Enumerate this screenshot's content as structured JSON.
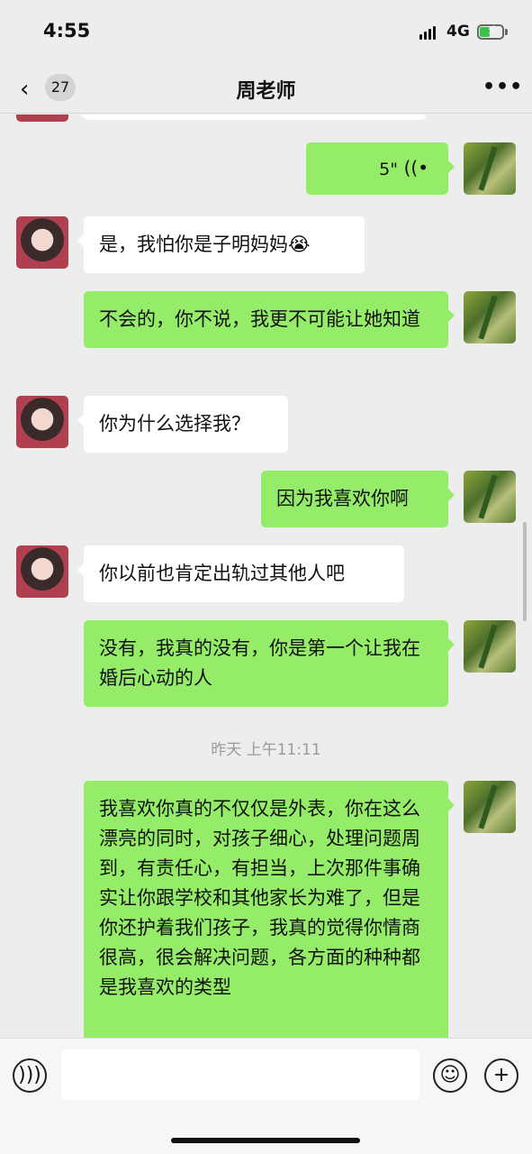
{
  "status": {
    "time": "4:55",
    "network": "4G"
  },
  "nav": {
    "back_icon": "‹",
    "unread_count": "27",
    "title": "周老师",
    "more_icon": "•••"
  },
  "messages": [
    {
      "side": "out",
      "type": "voice",
      "duration": "5\""
    },
    {
      "side": "in",
      "text": "是，我怕你是子明妈妈😭"
    },
    {
      "side": "out",
      "text": "不会的，你不说，我更不可能让她知道"
    },
    {
      "side": "in",
      "text": "你为什么选择我？"
    },
    {
      "side": "out",
      "text": "因为我喜欢你啊"
    },
    {
      "side": "in",
      "text": "你以前也肯定出轨过其他人吧"
    },
    {
      "side": "out",
      "text": "没有，我真的没有，你是第一个让我在婚后心动的人"
    },
    {
      "side": "out",
      "text": "我喜欢你真的不仅仅是外表，你在这么漂亮的同时，对孩子细心，处理问题周到，有责任心，有担当，上次那件事确实让你跟学校和其他家长为难了，但是你还护着我们孩子，我真的觉得你情商很高，很会解决问题，各方面的种种都是我喜欢的类型"
    }
  ],
  "timestamp": "昨天 上午11:11",
  "icons": {
    "voice_input": "voice-icon",
    "emoji": "emoji-icon",
    "add": "plus-icon"
  },
  "colors": {
    "bubble_out": "#95ec69",
    "bubble_in": "#ffffff",
    "background": "#ededed"
  }
}
